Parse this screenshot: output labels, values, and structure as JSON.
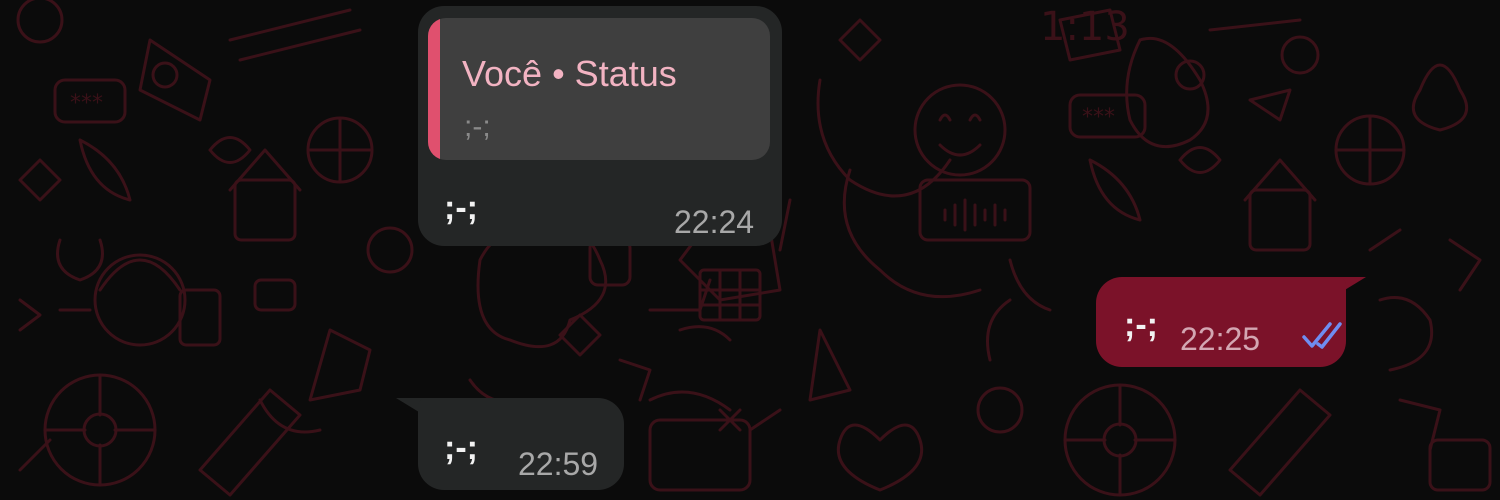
{
  "theme": {
    "wallpaper_bg": "#0b0b0b",
    "doodle_color": "#3a1118",
    "incoming_bubble": "#242626",
    "outgoing_bubble": "#7b1229",
    "quote_accent": "#e0506e",
    "read_checks": "#6f8df0"
  },
  "messages": [
    {
      "direction": "incoming",
      "quote": {
        "author": "Você • Status",
        "text": ";-;"
      },
      "text": ";-;",
      "time": "22:24"
    },
    {
      "direction": "outgoing",
      "text": ";-;",
      "time": "22:25",
      "status_icon": "double-check-read-icon"
    },
    {
      "direction": "incoming",
      "text": ";-;",
      "time": "22:59"
    }
  ]
}
